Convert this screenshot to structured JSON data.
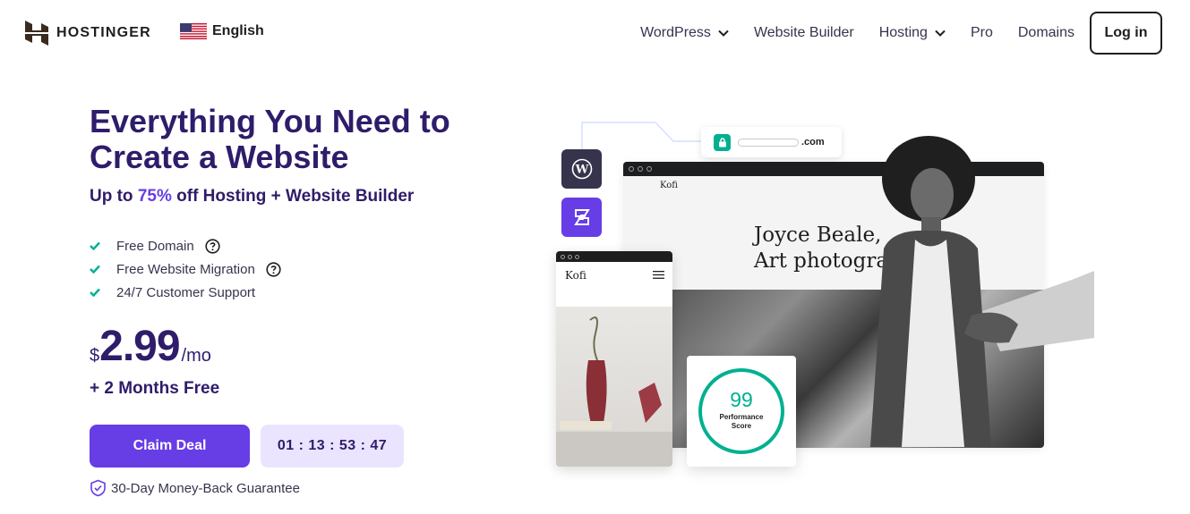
{
  "brand": {
    "name": "HOSTINGER"
  },
  "language": {
    "label": "English",
    "flag_icon": "us-flag-icon"
  },
  "nav": {
    "items": [
      {
        "label": "WordPress",
        "has_dropdown": true
      },
      {
        "label": "Website Builder",
        "has_dropdown": false
      },
      {
        "label": "Hosting",
        "has_dropdown": true
      },
      {
        "label": "Pro",
        "has_dropdown": false
      },
      {
        "label": "Domains",
        "has_dropdown": false
      }
    ],
    "login_label": "Log in"
  },
  "hero": {
    "title": "Everything You Need to Create a Website",
    "subtitle_prefix": "Up to ",
    "subtitle_accent": "75%",
    "subtitle_suffix": " off Hosting + Website Builder",
    "features": [
      {
        "label": "Free Domain",
        "has_help": true
      },
      {
        "label": "Free Website Migration",
        "has_help": true
      },
      {
        "label": "24/7 Customer Support",
        "has_help": false
      }
    ],
    "price": {
      "currency": "$",
      "amount": "2.99",
      "period": "/mo"
    },
    "bonus": "+ 2 Months Free",
    "cta_label": "Claim Deal",
    "timer": "01 : 13 : 53 : 47",
    "guarantee": "30-Day Money-Back Guarantee"
  },
  "illustration": {
    "url_tld": ".com",
    "site_name": "Kofi",
    "headline_line1": "Joyce Beale,",
    "headline_line2": "Art photograph",
    "mobile_site_name": "Kofi",
    "score_value": "99",
    "score_label_line1": "Performance",
    "score_label_line2": "Score"
  },
  "colors": {
    "primary": "#673de6",
    "heading": "#2f1c6a",
    "timer_bg": "#ebe4ff",
    "success": "#00b090"
  }
}
